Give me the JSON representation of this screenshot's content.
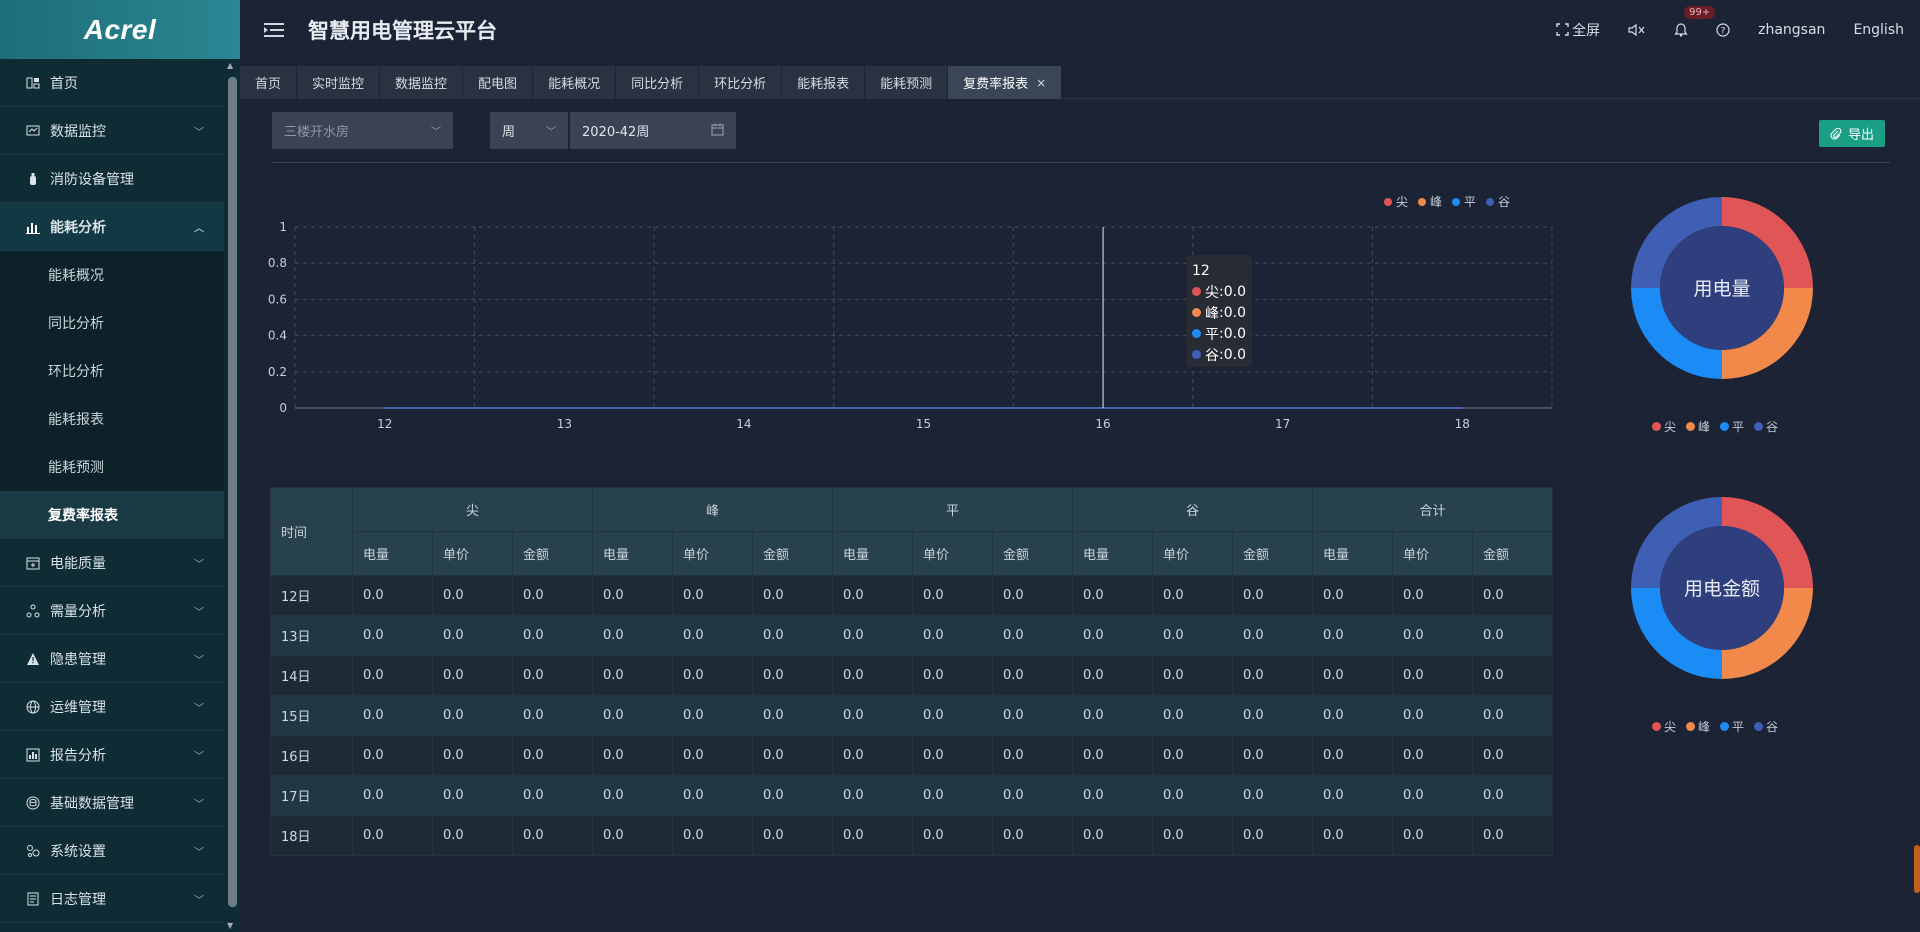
{
  "brand": {
    "logo_text": "Acrel"
  },
  "header": {
    "title": "智慧用电管理云平台",
    "fullscreen_label": "全屏",
    "notification_count": "99+",
    "username": "zhangsan",
    "language": "English"
  },
  "sidebar": {
    "items": [
      {
        "label": "首页",
        "icon": "home-icon"
      },
      {
        "label": "数据监控",
        "icon": "monitor-icon",
        "expandable": true
      },
      {
        "label": "消防设备管理",
        "icon": "extinguisher-icon"
      },
      {
        "label": "能耗分析",
        "icon": "bar-chart-icon",
        "expandable": true,
        "open": true,
        "children": [
          "能耗概况",
          "同比分析",
          "环比分析",
          "能耗报表",
          "能耗预测",
          "复费率报表"
        ],
        "active_child": "复费率报表"
      },
      {
        "label": "电能质量",
        "icon": "calendar-icon",
        "expandable": true
      },
      {
        "label": "需量分析",
        "icon": "nodes-icon",
        "expandable": true
      },
      {
        "label": "隐患管理",
        "icon": "warning-icon",
        "expandable": true
      },
      {
        "label": "运维管理",
        "icon": "globe-icon",
        "expandable": true
      },
      {
        "label": "报告分析",
        "icon": "report-icon",
        "expandable": true
      },
      {
        "label": "基础数据管理",
        "icon": "database-icon",
        "expandable": true
      },
      {
        "label": "系统设置",
        "icon": "gears-icon",
        "expandable": true
      },
      {
        "label": "日志管理",
        "icon": "log-icon",
        "expandable": true
      }
    ]
  },
  "tabs": [
    {
      "label": "首页"
    },
    {
      "label": "实时监控"
    },
    {
      "label": "数据监控"
    },
    {
      "label": "配电图"
    },
    {
      "label": "能耗概况"
    },
    {
      "label": "同比分析"
    },
    {
      "label": "环比分析"
    },
    {
      "label": "能耗报表"
    },
    {
      "label": "能耗预测"
    },
    {
      "label": "复费率报表",
      "active": true,
      "closable": true
    }
  ],
  "filters": {
    "location_placeholder": "三楼开水房",
    "period": "周",
    "date": "2020-42周",
    "export_label": "导出"
  },
  "colors": {
    "tip": "#e05656",
    "peak": "#f0894a",
    "flat": "#1b8cf5",
    "valley": "#3e5fb3",
    "accent": "#1a9f84"
  },
  "chart_data": [
    {
      "type": "line",
      "x": [
        "12",
        "13",
        "14",
        "15",
        "16",
        "17",
        "18"
      ],
      "ylim": [
        0,
        1
      ],
      "yticks": [
        "0",
        "0.2",
        "0.4",
        "0.6",
        "0.8",
        "1"
      ],
      "series": [
        {
          "name": "尖",
          "values": [
            0,
            0,
            0,
            0,
            0,
            0,
            0
          ]
        },
        {
          "name": "峰",
          "values": [
            0,
            0,
            0,
            0,
            0,
            0,
            0
          ]
        },
        {
          "name": "平",
          "values": [
            0,
            0,
            0,
            0,
            0,
            0,
            0
          ]
        },
        {
          "name": "谷",
          "values": [
            0,
            0,
            0,
            0,
            0,
            0,
            0
          ]
        }
      ],
      "legend_position": "top-right",
      "grid": true,
      "tooltip": {
        "x": "12",
        "rows": [
          {
            "name": "尖",
            "value": "0.0"
          },
          {
            "name": "峰",
            "value": "0.0"
          },
          {
            "name": "平",
            "value": "0.0"
          },
          {
            "name": "谷",
            "value": "0.0"
          }
        ]
      }
    },
    {
      "type": "pie",
      "title": "用电量",
      "labels": [
        "尖",
        "峰",
        "平",
        "谷"
      ],
      "values": [
        1,
        1,
        1,
        1
      ]
    },
    {
      "type": "pie",
      "title": "用电金额",
      "labels": [
        "尖",
        "峰",
        "平",
        "谷"
      ],
      "values": [
        1,
        1,
        1,
        1
      ]
    }
  ],
  "table": {
    "time_header": "时间",
    "groups": [
      "尖",
      "峰",
      "平",
      "谷",
      "合计"
    ],
    "sub_headers": [
      "电量",
      "单价",
      "金额"
    ],
    "rows": [
      {
        "time": "12日",
        "cells": [
          "0.0",
          "0.0",
          "0.0",
          "0.0",
          "0.0",
          "0.0",
          "0.0",
          "0.0",
          "0.0",
          "0.0",
          "0.0",
          "0.0",
          "0.0",
          "0.0",
          "0.0"
        ]
      },
      {
        "time": "13日",
        "cells": [
          "0.0",
          "0.0",
          "0.0",
          "0.0",
          "0.0",
          "0.0",
          "0.0",
          "0.0",
          "0.0",
          "0.0",
          "0.0",
          "0.0",
          "0.0",
          "0.0",
          "0.0"
        ]
      },
      {
        "time": "14日",
        "cells": [
          "0.0",
          "0.0",
          "0.0",
          "0.0",
          "0.0",
          "0.0",
          "0.0",
          "0.0",
          "0.0",
          "0.0",
          "0.0",
          "0.0",
          "0.0",
          "0.0",
          "0.0"
        ]
      },
      {
        "time": "15日",
        "cells": [
          "0.0",
          "0.0",
          "0.0",
          "0.0",
          "0.0",
          "0.0",
          "0.0",
          "0.0",
          "0.0",
          "0.0",
          "0.0",
          "0.0",
          "0.0",
          "0.0",
          "0.0"
        ]
      },
      {
        "time": "16日",
        "cells": [
          "0.0",
          "0.0",
          "0.0",
          "0.0",
          "0.0",
          "0.0",
          "0.0",
          "0.0",
          "0.0",
          "0.0",
          "0.0",
          "0.0",
          "0.0",
          "0.0",
          "0.0"
        ]
      },
      {
        "time": "17日",
        "cells": [
          "0.0",
          "0.0",
          "0.0",
          "0.0",
          "0.0",
          "0.0",
          "0.0",
          "0.0",
          "0.0",
          "0.0",
          "0.0",
          "0.0",
          "0.0",
          "0.0",
          "0.0"
        ]
      },
      {
        "time": "18日",
        "cells": [
          "0.0",
          "0.0",
          "0.0",
          "0.0",
          "0.0",
          "0.0",
          "0.0",
          "0.0",
          "0.0",
          "0.0",
          "0.0",
          "0.0",
          "0.0",
          "0.0",
          "0.0"
        ]
      }
    ]
  }
}
